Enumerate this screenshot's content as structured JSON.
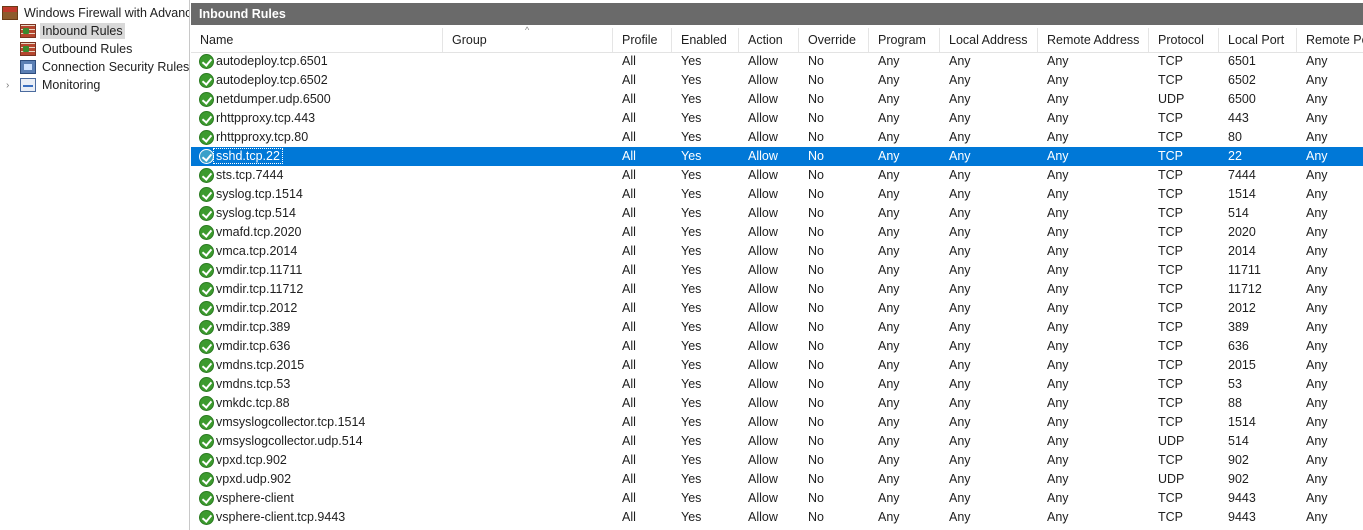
{
  "tree": {
    "root_label": "Windows Firewall with Advanced Security on Local Computer",
    "items": [
      {
        "label": "Inbound Rules",
        "selected": true
      },
      {
        "label": "Outbound Rules",
        "selected": false
      },
      {
        "label": "Connection Security Rules",
        "selected": false
      },
      {
        "label": "Monitoring",
        "selected": false
      }
    ]
  },
  "pane": {
    "title": "Inbound Rules"
  },
  "columns": [
    "Name",
    "Group",
    "Profile",
    "Enabled",
    "Action",
    "Override",
    "Program",
    "Local Address",
    "Remote Address",
    "Protocol",
    "Local Port",
    "Remote Port"
  ],
  "selected_row": 5,
  "rows": [
    [
      "autodeploy.tcp.6501",
      "",
      "All",
      "Yes",
      "Allow",
      "No",
      "Any",
      "Any",
      "Any",
      "TCP",
      "6501",
      "Any"
    ],
    [
      "autodeploy.tcp.6502",
      "",
      "All",
      "Yes",
      "Allow",
      "No",
      "Any",
      "Any",
      "Any",
      "TCP",
      "6502",
      "Any"
    ],
    [
      "netdumper.udp.6500",
      "",
      "All",
      "Yes",
      "Allow",
      "No",
      "Any",
      "Any",
      "Any",
      "UDP",
      "6500",
      "Any"
    ],
    [
      "rhttpproxy.tcp.443",
      "",
      "All",
      "Yes",
      "Allow",
      "No",
      "Any",
      "Any",
      "Any",
      "TCP",
      "443",
      "Any"
    ],
    [
      "rhttpproxy.tcp.80",
      "",
      "All",
      "Yes",
      "Allow",
      "No",
      "Any",
      "Any",
      "Any",
      "TCP",
      "80",
      "Any"
    ],
    [
      "sshd.tcp.22",
      "",
      "All",
      "Yes",
      "Allow",
      "No",
      "Any",
      "Any",
      "Any",
      "TCP",
      "22",
      "Any"
    ],
    [
      "sts.tcp.7444",
      "",
      "All",
      "Yes",
      "Allow",
      "No",
      "Any",
      "Any",
      "Any",
      "TCP",
      "7444",
      "Any"
    ],
    [
      "syslog.tcp.1514",
      "",
      "All",
      "Yes",
      "Allow",
      "No",
      "Any",
      "Any",
      "Any",
      "TCP",
      "1514",
      "Any"
    ],
    [
      "syslog.tcp.514",
      "",
      "All",
      "Yes",
      "Allow",
      "No",
      "Any",
      "Any",
      "Any",
      "TCP",
      "514",
      "Any"
    ],
    [
      "vmafd.tcp.2020",
      "",
      "All",
      "Yes",
      "Allow",
      "No",
      "Any",
      "Any",
      "Any",
      "TCP",
      "2020",
      "Any"
    ],
    [
      "vmca.tcp.2014",
      "",
      "All",
      "Yes",
      "Allow",
      "No",
      "Any",
      "Any",
      "Any",
      "TCP",
      "2014",
      "Any"
    ],
    [
      "vmdir.tcp.11711",
      "",
      "All",
      "Yes",
      "Allow",
      "No",
      "Any",
      "Any",
      "Any",
      "TCP",
      "11711",
      "Any"
    ],
    [
      "vmdir.tcp.11712",
      "",
      "All",
      "Yes",
      "Allow",
      "No",
      "Any",
      "Any",
      "Any",
      "TCP",
      "11712",
      "Any"
    ],
    [
      "vmdir.tcp.2012",
      "",
      "All",
      "Yes",
      "Allow",
      "No",
      "Any",
      "Any",
      "Any",
      "TCP",
      "2012",
      "Any"
    ],
    [
      "vmdir.tcp.389",
      "",
      "All",
      "Yes",
      "Allow",
      "No",
      "Any",
      "Any",
      "Any",
      "TCP",
      "389",
      "Any"
    ],
    [
      "vmdir.tcp.636",
      "",
      "All",
      "Yes",
      "Allow",
      "No",
      "Any",
      "Any",
      "Any",
      "TCP",
      "636",
      "Any"
    ],
    [
      "vmdns.tcp.2015",
      "",
      "All",
      "Yes",
      "Allow",
      "No",
      "Any",
      "Any",
      "Any",
      "TCP",
      "2015",
      "Any"
    ],
    [
      "vmdns.tcp.53",
      "",
      "All",
      "Yes",
      "Allow",
      "No",
      "Any",
      "Any",
      "Any",
      "TCP",
      "53",
      "Any"
    ],
    [
      "vmkdc.tcp.88",
      "",
      "All",
      "Yes",
      "Allow",
      "No",
      "Any",
      "Any",
      "Any",
      "TCP",
      "88",
      "Any"
    ],
    [
      "vmsyslogcollector.tcp.1514",
      "",
      "All",
      "Yes",
      "Allow",
      "No",
      "Any",
      "Any",
      "Any",
      "TCP",
      "1514",
      "Any"
    ],
    [
      "vmsyslogcollector.udp.514",
      "",
      "All",
      "Yes",
      "Allow",
      "No",
      "Any",
      "Any",
      "Any",
      "UDP",
      "514",
      "Any"
    ],
    [
      "vpxd.tcp.902",
      "",
      "All",
      "Yes",
      "Allow",
      "No",
      "Any",
      "Any",
      "Any",
      "TCP",
      "902",
      "Any"
    ],
    [
      "vpxd.udp.902",
      "",
      "All",
      "Yes",
      "Allow",
      "No",
      "Any",
      "Any",
      "Any",
      "UDP",
      "902",
      "Any"
    ],
    [
      "vsphere-client",
      "",
      "All",
      "Yes",
      "Allow",
      "No",
      "Any",
      "Any",
      "Any",
      "TCP",
      "9443",
      "Any"
    ],
    [
      "vsphere-client.tcp.9443",
      "",
      "All",
      "Yes",
      "Allow",
      "No",
      "Any",
      "Any",
      "Any",
      "TCP",
      "9443",
      "Any"
    ]
  ],
  "colors": {
    "selection": "#0078d7",
    "header_bar": "#6a6a6a",
    "enabled_icon": "#3c9a2e"
  },
  "icons": {
    "root": "firewall-icon",
    "inbound": "inbound-rules-icon",
    "outbound": "outbound-rules-icon",
    "connection": "connection-security-icon",
    "monitoring": "monitoring-icon",
    "rule": "rule-enabled-check-icon"
  }
}
